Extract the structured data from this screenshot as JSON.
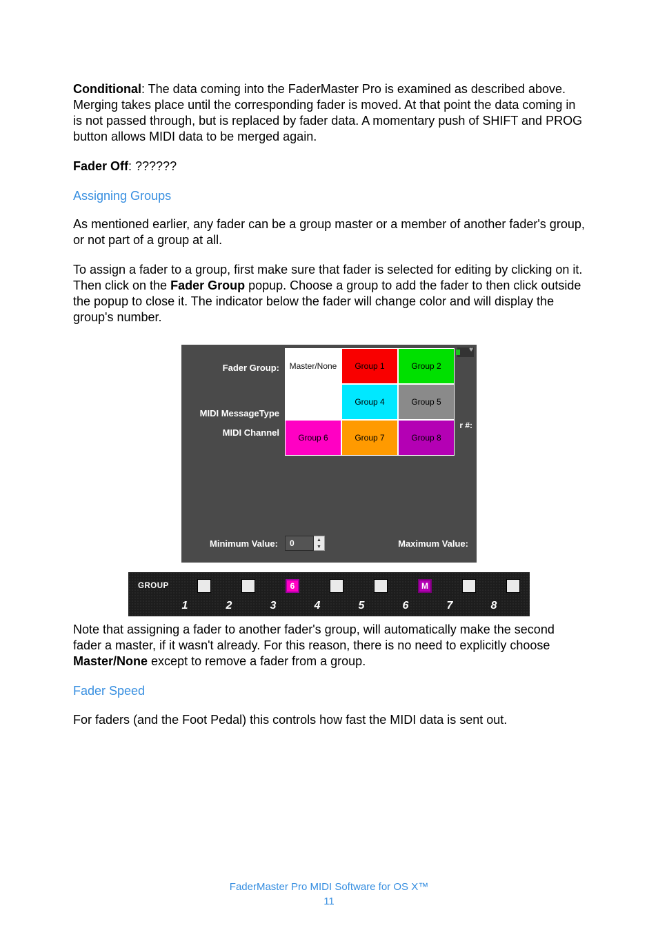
{
  "para": {
    "conditional_label": "Conditional",
    "conditional_text": ": The data coming into the FaderMaster Pro is examined as described above. Merging takes place until the corresponding fader is moved. At that point the data coming in is not passed through, but is replaced by fader data. A momentary push of SHIFT and PROG button allows MIDI data to be merged again.",
    "faderoff_label": "Fader Off",
    "faderoff_text": ": ??????",
    "heading1": "Assigning Groups",
    "p1": "As mentioned earlier, any fader can be a group master or a member of another fader's group, or not part of a group at all.",
    "p2a": "To assign a fader to a group, first make sure that fader is selected for editing by clicking on it. Then click on the ",
    "p2bold": "Fader Group",
    "p2b": " popup. Choose a group to add the fader to then click outside the popup to close it. The indicator below the fader will change color and will display the group's number.",
    "p3a": "Note that assigning a fader to another fader's group, will automatically make the second fader a master, if it wasn't already. For this reason, there is no need to explicitly choose ",
    "p3bold": "Master/None",
    "p3b": " except to remove a fader from a group.",
    "heading2": "Fader Speed",
    "p4": "For faders (and the Foot Pedal) this controls how fast the MIDI data is sent out."
  },
  "panel": {
    "fader_group_label": "Fader Group:",
    "midi_msgtype_label": "MIDI MessageType",
    "midi_channel_label": "MIDI Channel",
    "min_label": "Minimum Value:",
    "min_value": "0",
    "max_label": "Maximum Value:",
    "r_tail": "r #:",
    "cells": [
      {
        "label": "Master/None",
        "bg": "#ffffff",
        "fg": "#222222"
      },
      {
        "label": "Group 1",
        "bg": "#f90000",
        "fg": "#000000"
      },
      {
        "label": "Group 2",
        "bg": "#00e000",
        "fg": "#000000"
      },
      {
        "label": "",
        "bg": "#ffffff",
        "fg": "#000000"
      },
      {
        "label": "Group 4",
        "bg": "#00e8ff",
        "fg": "#000000"
      },
      {
        "label": "Group 5",
        "bg": "#8a8a8a",
        "fg": "#000000"
      },
      {
        "label": "Group 6",
        "bg": "#ff00c3",
        "fg": "#000000"
      },
      {
        "label": "Group 7",
        "bg": "#ff9a00",
        "fg": "#000000"
      },
      {
        "label": "Group 8",
        "bg": "#b400b4",
        "fg": "#000000"
      }
    ]
  },
  "strip": {
    "label": "GROUP",
    "boxes": [
      {
        "text": "",
        "cls": ""
      },
      {
        "text": "",
        "cls": ""
      },
      {
        "text": "6",
        "cls": "mag"
      },
      {
        "text": "",
        "cls": ""
      },
      {
        "text": "",
        "cls": ""
      },
      {
        "text": "M",
        "cls": "magM"
      },
      {
        "text": "",
        "cls": ""
      },
      {
        "text": "",
        "cls": ""
      }
    ],
    "numbers": [
      "1",
      "2",
      "3",
      "4",
      "5",
      "6",
      "7",
      "8"
    ]
  },
  "footer": {
    "line1": "FaderMaster Pro MIDI Software for OS X™",
    "line2": "11"
  }
}
